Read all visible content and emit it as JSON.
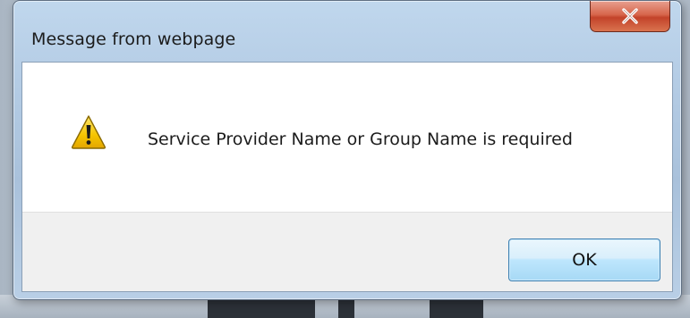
{
  "dialog": {
    "title": "Message from webpage",
    "message": "Service Provider Name or Group Name is required",
    "ok_label": "OK",
    "icon": "warning-icon",
    "close_icon": "close-icon"
  },
  "colors": {
    "close_button": "#c3432a",
    "ok_button_border": "#3c7fb1",
    "button_area_bg": "#f0f0f0",
    "warning_fill": "#f5c400"
  }
}
